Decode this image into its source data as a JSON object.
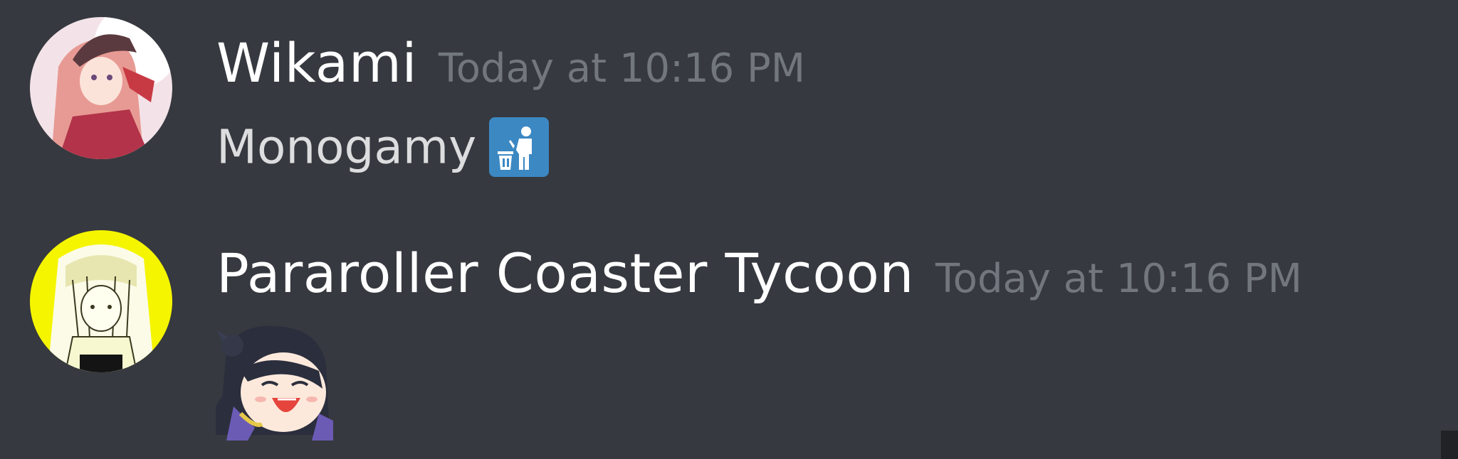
{
  "messages": [
    {
      "author": "Wikami",
      "timestamp": "Today at 10:16 PM",
      "text": "Monogamy",
      "emoji": "wastebasket-icon"
    },
    {
      "author": "Pararoller Coaster Tycoon",
      "timestamp": "Today at 10:16 PM",
      "sticker": "laughing-chibi-emote"
    }
  ],
  "theme": {
    "background": "#36393f",
    "username_color": "#ffffff",
    "timestamp_color": "#72767d",
    "text_color": "#dcddde",
    "emoji_blue": "#3b88c3",
    "avatar_2_accent": "#f5f500"
  }
}
